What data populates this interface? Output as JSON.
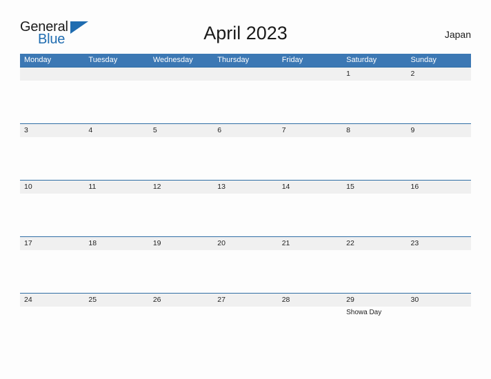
{
  "brand": {
    "name_top": "General",
    "name_bottom": "Blue",
    "accent_color": "#1f6cb0"
  },
  "header": {
    "title": "April 2023",
    "region": "Japan"
  },
  "theme": {
    "header_blue": "#3c78b4",
    "rule_blue": "#2e6da4",
    "band_gray": "#f0f0f0",
    "page_background": "#fdfdfd",
    "text_color": "#222222"
  },
  "calendar": {
    "weekdays": [
      "Monday",
      "Tuesday",
      "Wednesday",
      "Thursday",
      "Friday",
      "Saturday",
      "Sunday"
    ],
    "weeks": [
      {
        "dates": [
          "",
          "",
          "",
          "",
          "",
          "1",
          "2"
        ],
        "events": [
          "",
          "",
          "",
          "",
          "",
          "",
          ""
        ]
      },
      {
        "dates": [
          "3",
          "4",
          "5",
          "6",
          "7",
          "8",
          "9"
        ],
        "events": [
          "",
          "",
          "",
          "",
          "",
          "",
          ""
        ]
      },
      {
        "dates": [
          "10",
          "11",
          "12",
          "13",
          "14",
          "15",
          "16"
        ],
        "events": [
          "",
          "",
          "",
          "",
          "",
          "",
          ""
        ]
      },
      {
        "dates": [
          "17",
          "18",
          "19",
          "20",
          "21",
          "22",
          "23"
        ],
        "events": [
          "",
          "",
          "",
          "",
          "",
          "",
          ""
        ]
      },
      {
        "dates": [
          "24",
          "25",
          "26",
          "27",
          "28",
          "29",
          "30"
        ],
        "events": [
          "",
          "",
          "",
          "",
          "",
          "Showa Day",
          ""
        ]
      }
    ]
  }
}
